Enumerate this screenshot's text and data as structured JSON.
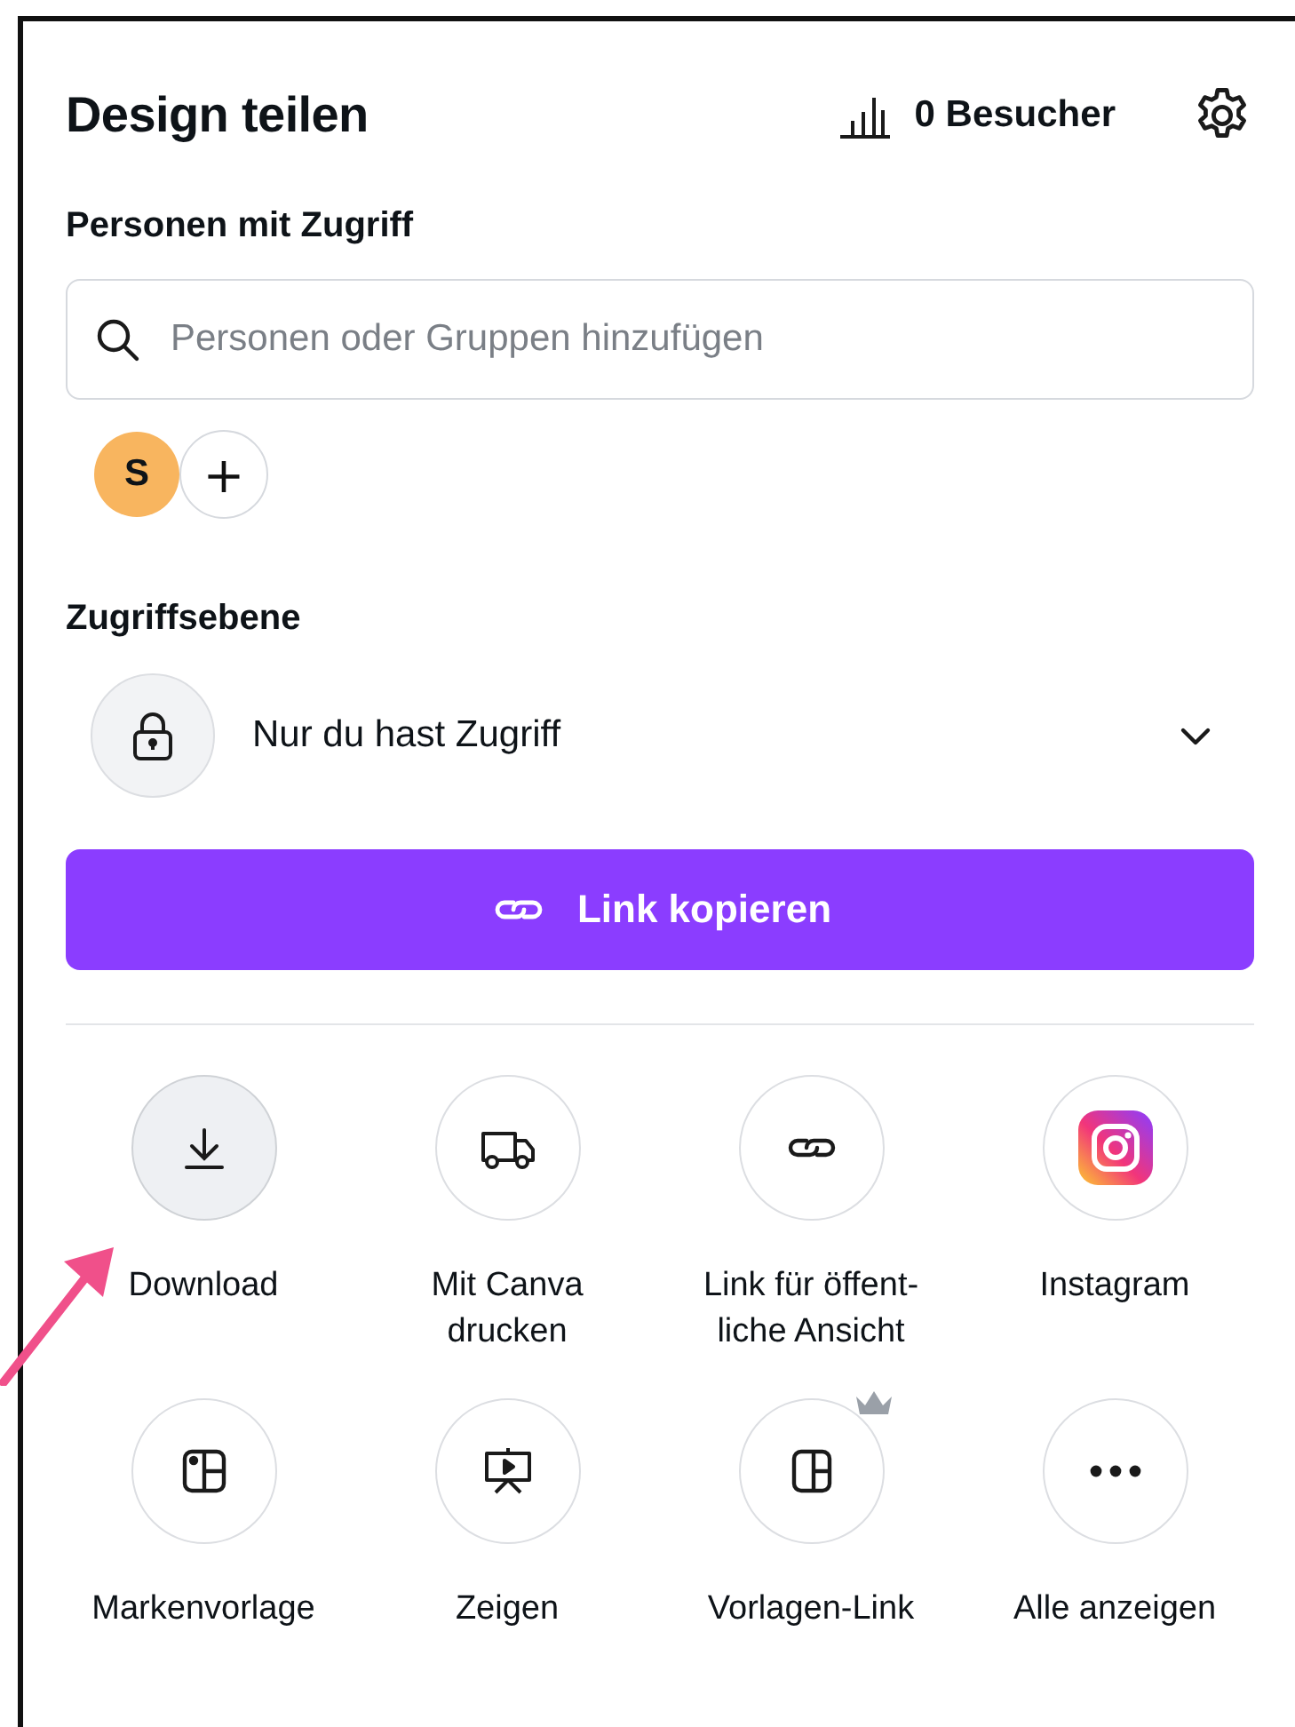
{
  "header": {
    "title": "Design teilen",
    "visitors": "0 Besucher"
  },
  "people": {
    "heading": "Personen mit Zugriff",
    "search": {
      "placeholder": "Personen oder Gruppen hinzufügen"
    },
    "avatars": [
      {
        "initial": "S",
        "color": "#f8b55f"
      }
    ],
    "add": "+"
  },
  "access": {
    "heading": "Zugriffsebene",
    "value": "Nur du hast Zugriff"
  },
  "copy_button": "Link kopieren",
  "actions": [
    {
      "kind": "download",
      "label": "Download",
      "selected": true
    },
    {
      "kind": "print",
      "label": "Mit Canva drucken",
      "selected": false
    },
    {
      "kind": "link",
      "label": "Link für öffent-liche Ansicht",
      "selected": false
    },
    {
      "kind": "instagram",
      "label": "Instagram",
      "selected": false
    },
    {
      "kind": "brand",
      "label": "Markenvorlage",
      "selected": false
    },
    {
      "kind": "present",
      "label": "Zeigen",
      "selected": false
    },
    {
      "kind": "template",
      "label": "Vorlagen-Link",
      "selected": false,
      "premium": true
    },
    {
      "kind": "more",
      "label": "Alle anzeigen",
      "selected": false
    }
  ],
  "annotation": {
    "kind": "arrow"
  }
}
